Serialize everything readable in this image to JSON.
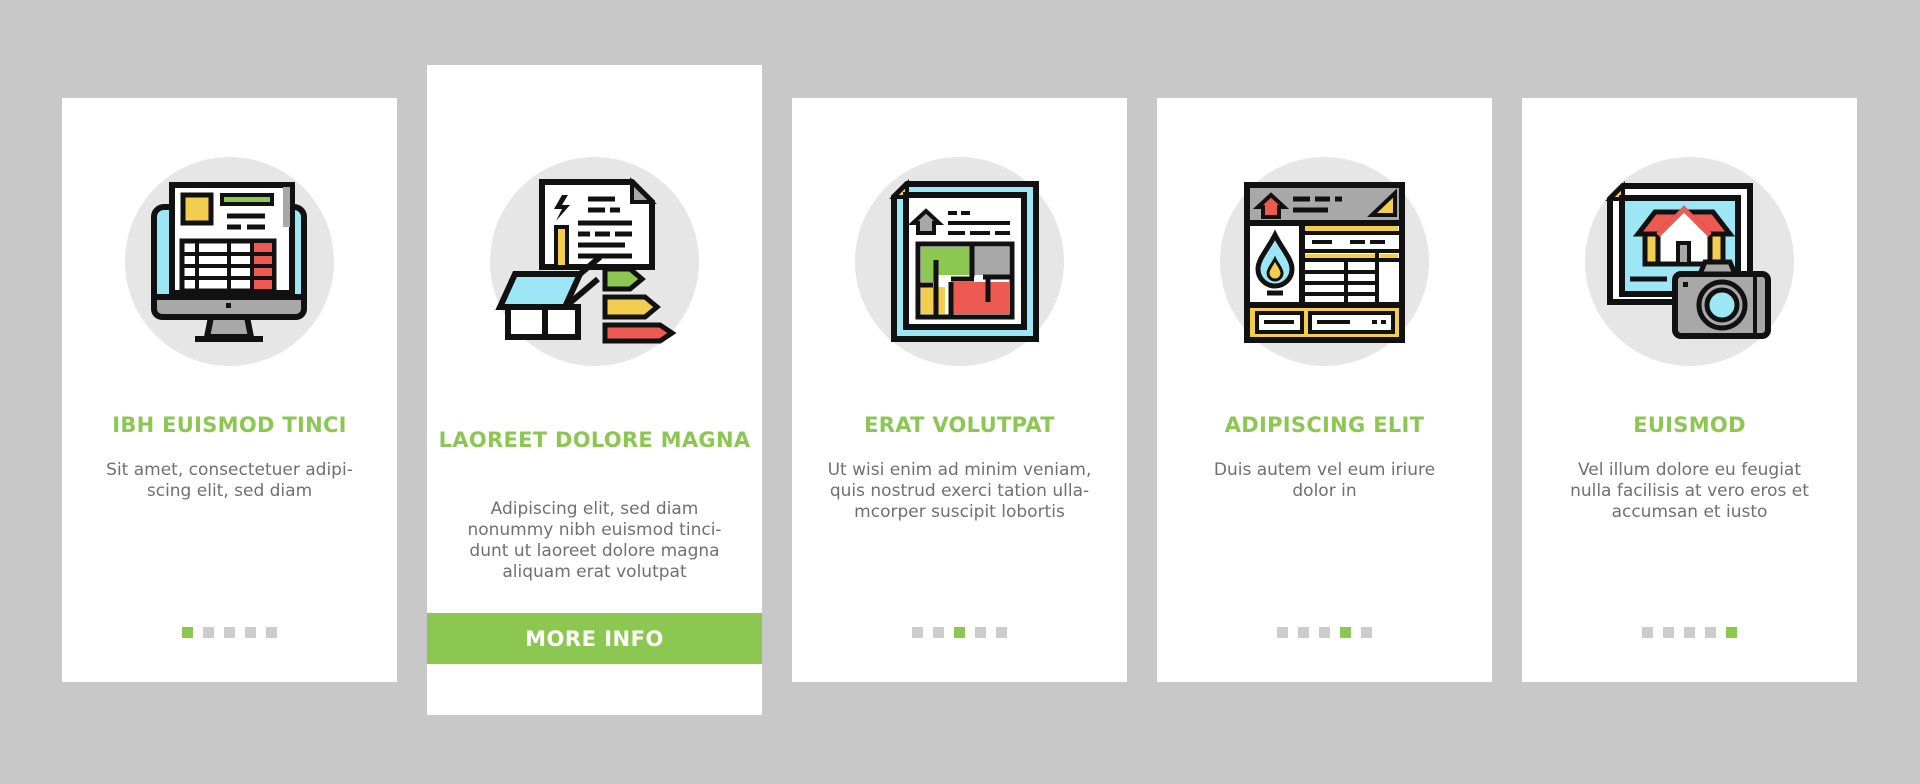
{
  "colors": {
    "accent": "#8cc751",
    "background": "#c8c8c8",
    "card": "#ffffff",
    "icon_circle": "#e6e6e6",
    "body_text": "#707070",
    "dot_inactive": "#cccccc"
  },
  "cards": [
    {
      "icon": "computer-invoice-icon",
      "title": "IBH EUISMOD TINCI",
      "description": "Sit amet, consectetuer adipi-\nscing elit, sed diam",
      "page_index": 1,
      "page_count": 5
    },
    {
      "icon": "energy-rating-document-icon",
      "title": "LAOREET DOLORE MAGNA",
      "description": "Adipiscing elit, sed diam nonummy nibh euismod tinci-\ndunt ut laoreet dolore magna aliquam erat volutpat",
      "button_label": "MORE INFO"
    },
    {
      "icon": "floor-plan-document-icon",
      "title": "ERAT VOLUTPAT",
      "description": "Ut wisi enim ad minim veniam, quis nostrud exerci tation ulla-\nmcorper suscipit lobortis",
      "page_index": 3,
      "page_count": 5
    },
    {
      "icon": "gas-bill-document-icon",
      "title": "ADIPISCING ELIT",
      "description": "Duis autem vel eum iriure dolor in",
      "page_index": 4,
      "page_count": 5
    },
    {
      "icon": "house-photo-camera-icon",
      "title": "EUISMOD",
      "description": "Vel illum dolore eu feugiat nulla facilisis at vero eros et accumsan et iusto",
      "page_index": 5,
      "page_count": 5
    }
  ]
}
